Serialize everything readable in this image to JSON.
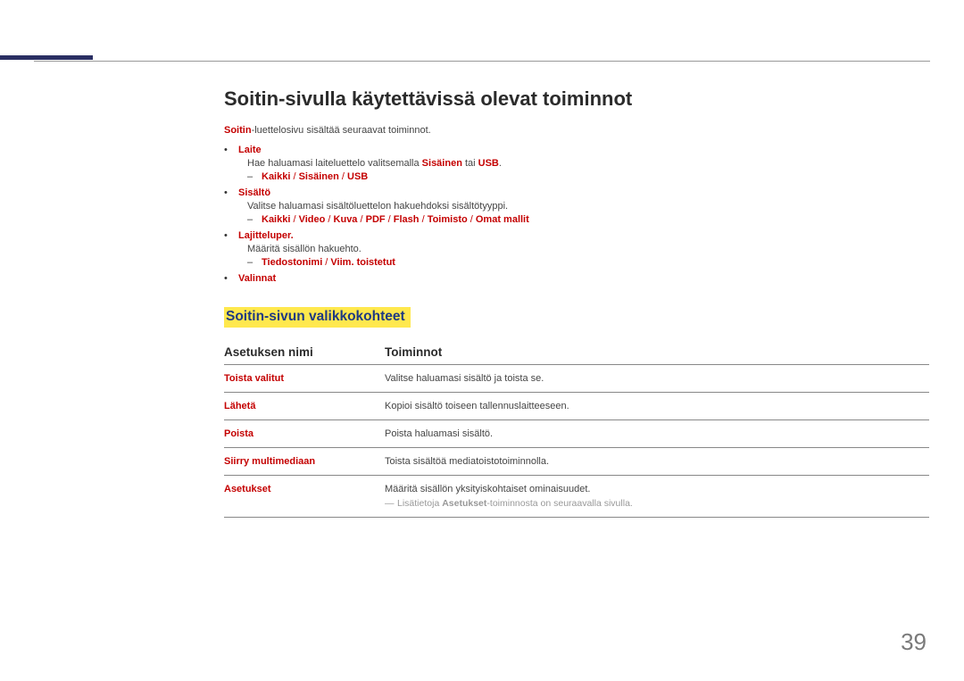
{
  "title": "Soitin-sivulla käytettävissä olevat toiminnot",
  "intro": {
    "prefix_bold": "Soitin",
    "rest": "-luettelosivu sisältää seuraavat toiminnot."
  },
  "items": [
    {
      "label": "Laite",
      "desc_parts": [
        "Hae haluamasi laiteluettelo valitsemalla ",
        "Sisäinen",
        " tai ",
        "USB",
        "."
      ],
      "sub": {
        "options": [
          "Kaikki",
          "Sisäinen",
          "USB"
        ]
      }
    },
    {
      "label": "Sisältö",
      "desc": "Valitse haluamasi sisältöluettelon hakuehdoksi sisältötyyppi.",
      "sub": {
        "options": [
          "Kaikki",
          "Video",
          "Kuva",
          "PDF",
          "Flash",
          "Toimisto",
          "Omat mallit"
        ]
      }
    },
    {
      "label": "Lajitteluper.",
      "desc": "Määritä sisällön hakuehto.",
      "sub": {
        "options": [
          "Tiedostonimi",
          "Viim. toistetut"
        ]
      }
    },
    {
      "label": "Valinnat"
    }
  ],
  "subheading": "Soitin-sivun valikkokohteet",
  "table": {
    "headers": [
      "Asetuksen nimi",
      "Toiminnot"
    ],
    "rows": [
      {
        "name": "Toista valitut",
        "func": "Valitse haluamasi sisältö ja toista se."
      },
      {
        "name": "Lähetä",
        "func": "Kopioi sisältö toiseen tallennuslaitteeseen."
      },
      {
        "name": "Poista",
        "func": "Poista haluamasi sisältö."
      },
      {
        "name": "Siirry multimediaan",
        "func": "Toista sisältöä mediatoistotoiminnolla."
      },
      {
        "name": "Asetukset",
        "func": "Määritä sisällön yksityiskohtaiset ominaisuudet.",
        "note_parts": [
          "Lisätietoja ",
          "Asetukset",
          "-toiminnosta on seuraavalla sivulla."
        ]
      }
    ]
  },
  "page_number": "39"
}
